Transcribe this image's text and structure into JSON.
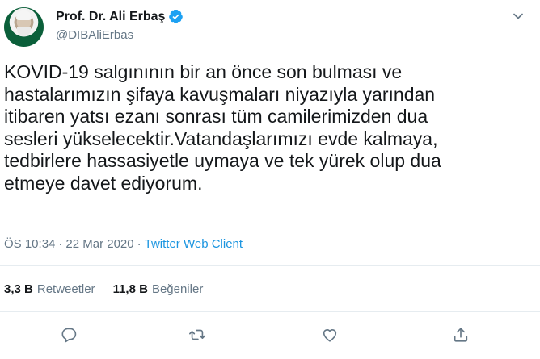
{
  "author": {
    "display_name": "Prof. Dr. Ali Erbaş",
    "handle": "@DIBAliErbas",
    "verified": true
  },
  "tweet": {
    "text": "KOVID-19 salgınının bir an önce son bulması ve\nhastalarımızın şifaya kavuşmaları niyazıyla yarından\nitibaren yatsı ezanı sonrası tüm camilerimizden dua\nsesleri yükselecektir.Vatandaşlarımızı evde kalmaya,\ntedbirlere hassasiyetle uymaya ve tek yürek olup dua\netmeye davet ediyorum.",
    "time": "ÖS 10:34",
    "separator1": "·",
    "date": "22 Mar 2020",
    "separator2": "·",
    "client": "Twitter Web Client"
  },
  "stats": {
    "retweets_count": "3,3 B",
    "retweets_label": "Retweetler",
    "likes_count": "11,8 B",
    "likes_label": "Beğeniler"
  },
  "icons": {
    "more": "chevron-down-icon",
    "reply": "reply-icon",
    "retweet": "retweet-icon",
    "like": "heart-icon",
    "share": "share-icon"
  },
  "colors": {
    "text": "#14171a",
    "secondary": "#657786",
    "link": "#1b95e0",
    "verified": "#1da1f2",
    "divider": "#e6ecf0"
  }
}
